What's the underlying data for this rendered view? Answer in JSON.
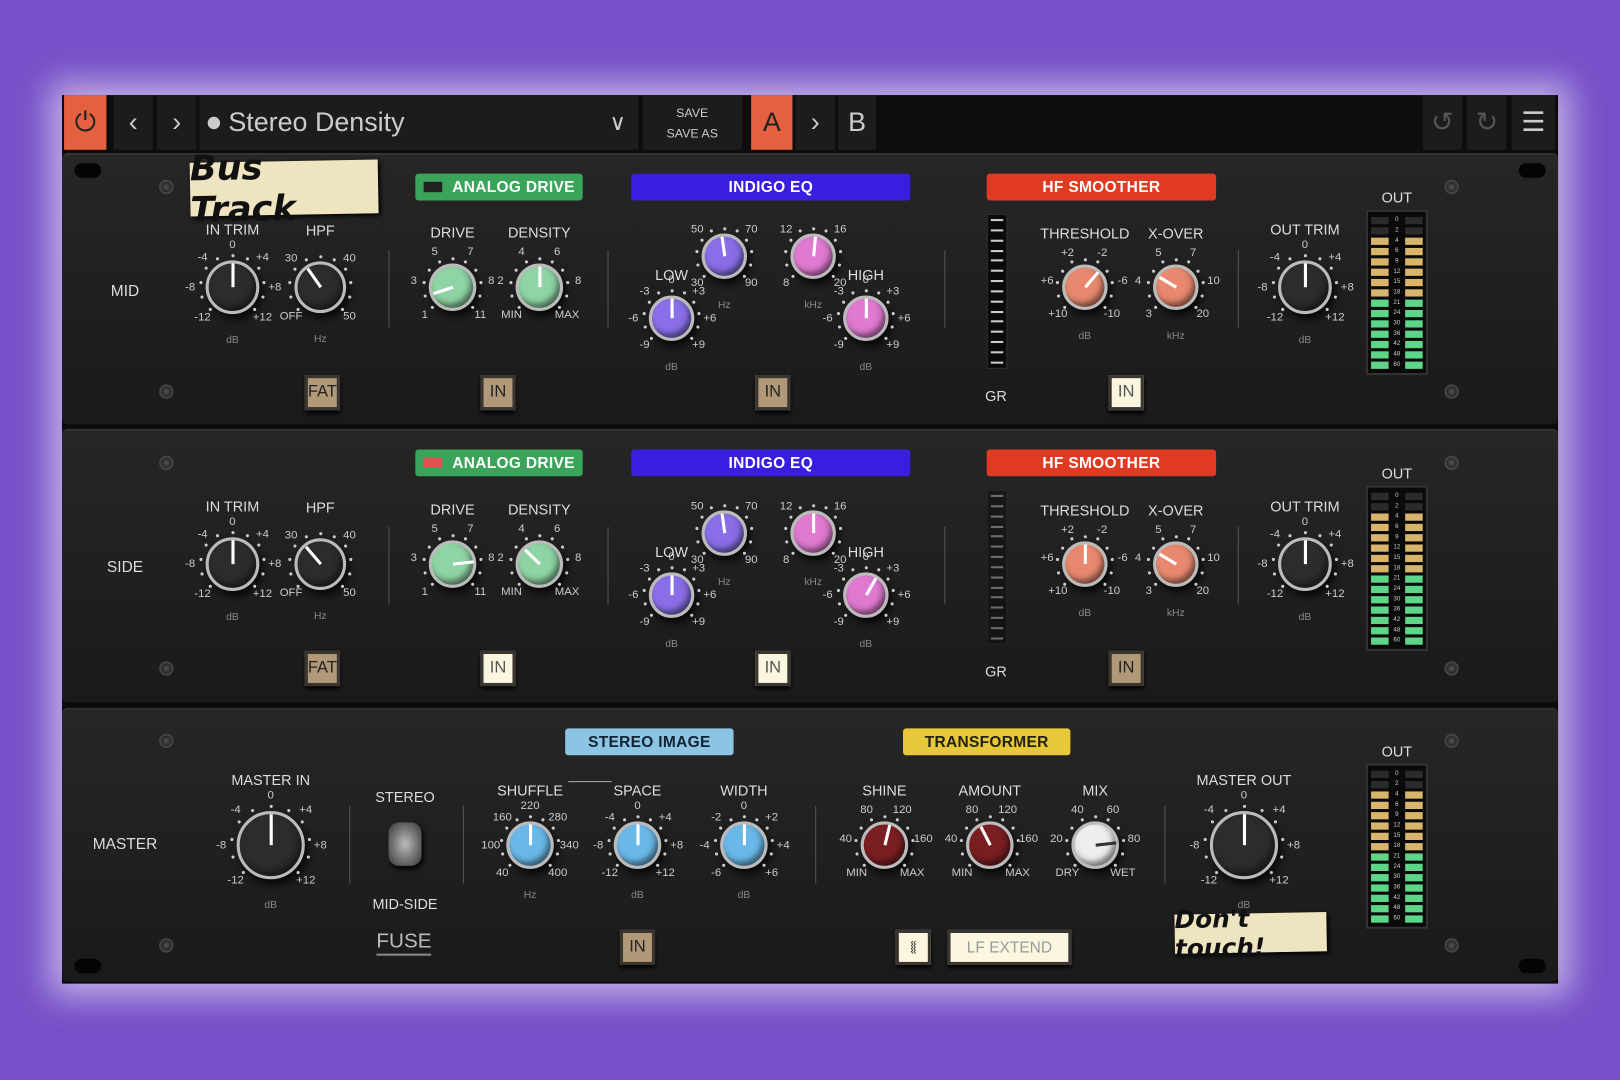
{
  "toolbar": {
    "preset_name": "Stereo Density",
    "save": "SAVE",
    "save_as": "SAVE AS",
    "a": "A",
    "b": "B",
    "power_color": "#e5603e"
  },
  "mid": {
    "row_label": "MID",
    "sticker": "Bus Track",
    "headers": {
      "analog_drive": "ANALOG DRIVE",
      "indigo_eq": "INDIGO EQ",
      "hf_smoother": "HF SMOOTHER"
    },
    "knobs": [
      {
        "label": "IN TRIM",
        "ticks": [
          "-12",
          "-8",
          "-4",
          "0",
          "+4",
          "+8",
          "+12"
        ],
        "unit": "dB",
        "color": "#2c2c2c",
        "value": 0.5
      },
      {
        "label": "HPF",
        "ticks": [
          "OFF",
          "30",
          "40",
          "50"
        ],
        "unit": "Hz",
        "color": "#2c2c2c",
        "value": 0.37
      },
      {
        "label": "DRIVE",
        "ticks": [
          "1",
          "3",
          "5",
          "7",
          "8",
          "11"
        ],
        "unit": "",
        "color": "#8fd4a4",
        "value": 0.1
      },
      {
        "label": "DENSITY",
        "ticks": [
          "MIN",
          "2",
          "4",
          "6",
          "8",
          "MAX"
        ],
        "unit": "",
        "color": "#8fd4a4",
        "value": 0.5
      },
      {
        "label": "LOW",
        "ticks": [
          "-9",
          "-6",
          "-3",
          "0",
          "+3",
          "+6",
          "+9"
        ],
        "unit": "dB",
        "color": "#8a6ee8",
        "value": 0.5
      },
      {
        "label": "",
        "ticks": [
          "30",
          "50",
          "70",
          "90"
        ],
        "unit": "Hz",
        "color": "#8a6ee8",
        "value": 0.47
      },
      {
        "label": "",
        "ticks": [
          "8",
          "12",
          "16",
          "20"
        ],
        "unit": "kHz",
        "color": "#e07ad0",
        "value": 0.52
      },
      {
        "label": "HIGH",
        "ticks": [
          "-9",
          "-6",
          "-3",
          "0",
          "+3",
          "+6",
          "+9"
        ],
        "unit": "dB",
        "color": "#e07ad0",
        "value": 0.5
      },
      {
        "label": "THRESHOLD",
        "ticks": [
          "+10",
          "+6",
          "+2",
          "-2",
          "-6",
          "-10"
        ],
        "unit": "dB",
        "color": "#e8896f",
        "value": 0.65
      },
      {
        "label": "X-OVER",
        "ticks": [
          "3",
          "4",
          "5",
          "7",
          "10",
          "20"
        ],
        "unit": "kHz",
        "color": "#e8896f",
        "value": 0.28
      },
      {
        "label": "OUT TRIM",
        "ticks": [
          "-12",
          "-8",
          "-4",
          "0",
          "+4",
          "+8",
          "+12"
        ],
        "unit": "dB",
        "color": "#2c2c2c",
        "value": 0.5
      }
    ],
    "buttons": {
      "fat": "FAT",
      "drive_in": "IN",
      "eq_in": "IN",
      "hf_in": "IN"
    },
    "gr": "GR",
    "out": "OUT",
    "out_meter_level": 0.87
  },
  "side": {
    "row_label": "SIDE",
    "headers": {
      "analog_drive": "ANALOG DRIVE",
      "indigo_eq": "INDIGO EQ",
      "hf_smoother": "HF SMOOTHER"
    },
    "knobs": [
      {
        "label": "IN TRIM",
        "ticks": [
          "-12",
          "-8",
          "-4",
          "0",
          "+4",
          "+8",
          "+12"
        ],
        "unit": "dB",
        "color": "#2c2c2c",
        "value": 0.5
      },
      {
        "label": "HPF",
        "ticks": [
          "OFF",
          "30",
          "40",
          "50"
        ],
        "unit": "Hz",
        "color": "#2c2c2c",
        "value": 0.35
      },
      {
        "label": "DRIVE",
        "ticks": [
          "1",
          "3",
          "5",
          "7",
          "8",
          "11"
        ],
        "unit": "",
        "color": "#8fd4a4",
        "value": 0.81
      },
      {
        "label": "DENSITY",
        "ticks": [
          "MIN",
          "2",
          "4",
          "6",
          "8",
          "MAX"
        ],
        "unit": "",
        "color": "#8fd4a4",
        "value": 0.33
      },
      {
        "label": "LOW",
        "ticks": [
          "-9",
          "-6",
          "-3",
          "0",
          "+3",
          "+6",
          "+9"
        ],
        "unit": "dB",
        "color": "#8a6ee8",
        "value": 0.5
      },
      {
        "label": "",
        "ticks": [
          "30",
          "50",
          "70",
          "90"
        ],
        "unit": "Hz",
        "color": "#8a6ee8",
        "value": 0.47
      },
      {
        "label": "",
        "ticks": [
          "8",
          "12",
          "16",
          "20"
        ],
        "unit": "kHz",
        "color": "#e07ad0",
        "value": 0.5
      },
      {
        "label": "HIGH",
        "ticks": [
          "-9",
          "-6",
          "-3",
          "0",
          "+3",
          "+6",
          "+9"
        ],
        "unit": "dB",
        "color": "#e07ad0",
        "value": 0.61
      },
      {
        "label": "THRESHOLD",
        "ticks": [
          "+10",
          "+6",
          "+2",
          "-2",
          "-6",
          "-10"
        ],
        "unit": "dB",
        "color": "#e8896f",
        "value": 0.5
      },
      {
        "label": "X-OVER",
        "ticks": [
          "3",
          "4",
          "5",
          "7",
          "10",
          "20"
        ],
        "unit": "kHz",
        "color": "#e8896f",
        "value": 0.28
      },
      {
        "label": "OUT TRIM",
        "ticks": [
          "-12",
          "-8",
          "-4",
          "0",
          "+4",
          "+8",
          "+12"
        ],
        "unit": "dB",
        "color": "#2c2c2c",
        "value": 0.5
      }
    ],
    "buttons": {
      "fat": "FAT",
      "drive_in": "IN",
      "eq_in": "IN",
      "hf_in": "IN"
    },
    "gr": "GR",
    "out": "OUT",
    "out_meter_level": 0.87
  },
  "master": {
    "row_label": "MASTER",
    "sticker": "Don't touch!",
    "logo": "FUSE",
    "headers": {
      "stereo_image": "STEREO IMAGE",
      "transformer": "TRANSFORMER"
    },
    "switch": {
      "top": "STEREO",
      "bottom": "MID-SIDE"
    },
    "knobs": [
      {
        "label": "MASTER IN",
        "ticks": [
          "-12",
          "-8",
          "-4",
          "0",
          "+4",
          "+8",
          "+12"
        ],
        "unit": "dB",
        "color": "#2c2c2c",
        "value": 0.5
      },
      {
        "label": "SHUFFLE",
        "ticks": [
          "40",
          "100",
          "160",
          "220",
          "280",
          "340",
          "400"
        ],
        "unit": "Hz",
        "color": "#6ab8e8",
        "value": 0.5
      },
      {
        "label": "SPACE",
        "ticks": [
          "-12",
          "-8",
          "-4",
          "0",
          "+4",
          "+8",
          "+12"
        ],
        "unit": "dB",
        "color": "#6ab8e8",
        "value": 0.5
      },
      {
        "label": "WIDTH",
        "ticks": [
          "-6",
          "-4",
          "-2",
          "0",
          "+2",
          "+4",
          "+6"
        ],
        "unit": "dB",
        "color": "#6ab8e8",
        "value": 0.5
      },
      {
        "label": "SHINE",
        "ticks": [
          "MIN",
          "40",
          "80",
          "120",
          "160",
          "MAX"
        ],
        "unit": "",
        "color": "#7a1e22",
        "value": 0.55
      },
      {
        "label": "AMOUNT",
        "ticks": [
          "MIN",
          "40",
          "80",
          "120",
          "160",
          "MAX"
        ],
        "unit": "",
        "color": "#7a1e22",
        "value": 0.4
      },
      {
        "label": "MIX",
        "ticks": [
          "DRY",
          "20",
          "40",
          "60",
          "80",
          "WET"
        ],
        "unit": "",
        "color": "#eeeeee",
        "value": 0.81
      },
      {
        "label": "MASTER OUT",
        "ticks": [
          "-12",
          "-8",
          "-4",
          "0",
          "+4",
          "+8",
          "+12"
        ],
        "unit": "dB",
        "color": "#2c2c2c",
        "value": 0.5
      }
    ],
    "buttons": {
      "image_in": "IN",
      "lf_extend": "LF EXTEND"
    },
    "out": "OUT",
    "out_meter_level": 0.87
  },
  "meter_scale": [
    "0",
    "2",
    "4",
    "6",
    "9",
    "12",
    "15",
    "18",
    "21",
    "24",
    "30",
    "36",
    "42",
    "48",
    "60"
  ]
}
